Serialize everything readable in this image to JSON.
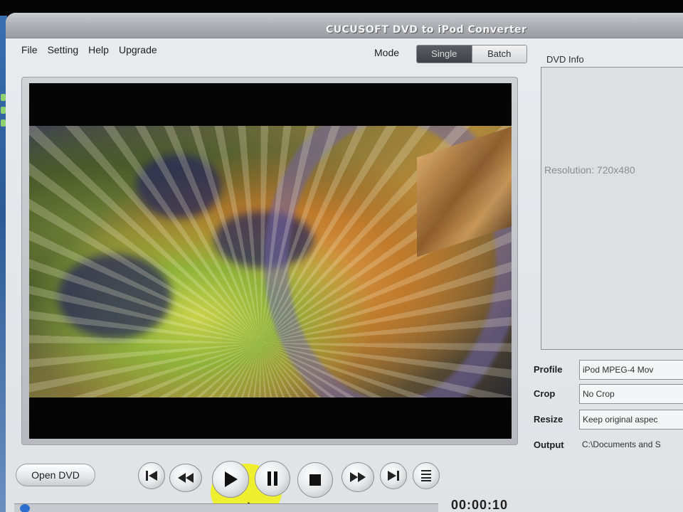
{
  "window": {
    "title": "CUCUSOFT DVD to  iPod  Converter"
  },
  "menu": {
    "items": [
      "File",
      "Setting",
      "Help",
      "Upgrade"
    ]
  },
  "mode": {
    "label": "Mode",
    "options": [
      "Single",
      "Batch"
    ],
    "selected": "Single"
  },
  "dvd_info": {
    "label": "DVD Info",
    "resolution": "Resolution: 720x480"
  },
  "settings": {
    "profile": {
      "label": "Profile",
      "value": "iPod  MPEG-4 Mov"
    },
    "crop": {
      "label": "Crop",
      "value": "No Crop"
    },
    "resize": {
      "label": "Resize",
      "value": "Keep original aspec"
    },
    "output": {
      "label": "Output",
      "value": "C:\\Documents and S"
    }
  },
  "controls": {
    "open_dvd": "Open DVD",
    "buttons": [
      "first-chapter",
      "rewind",
      "play",
      "pause",
      "stop",
      "fast-forward",
      "last-chapter",
      "chapter-list"
    ]
  },
  "playback": {
    "time": "00:00:10",
    "progress": 0.01
  },
  "colors": {
    "window_bg": "#e3e7ea",
    "titlebar": "#a9adb2",
    "accent_blue": "#2d6fd0",
    "highlight": "#f0f014"
  }
}
